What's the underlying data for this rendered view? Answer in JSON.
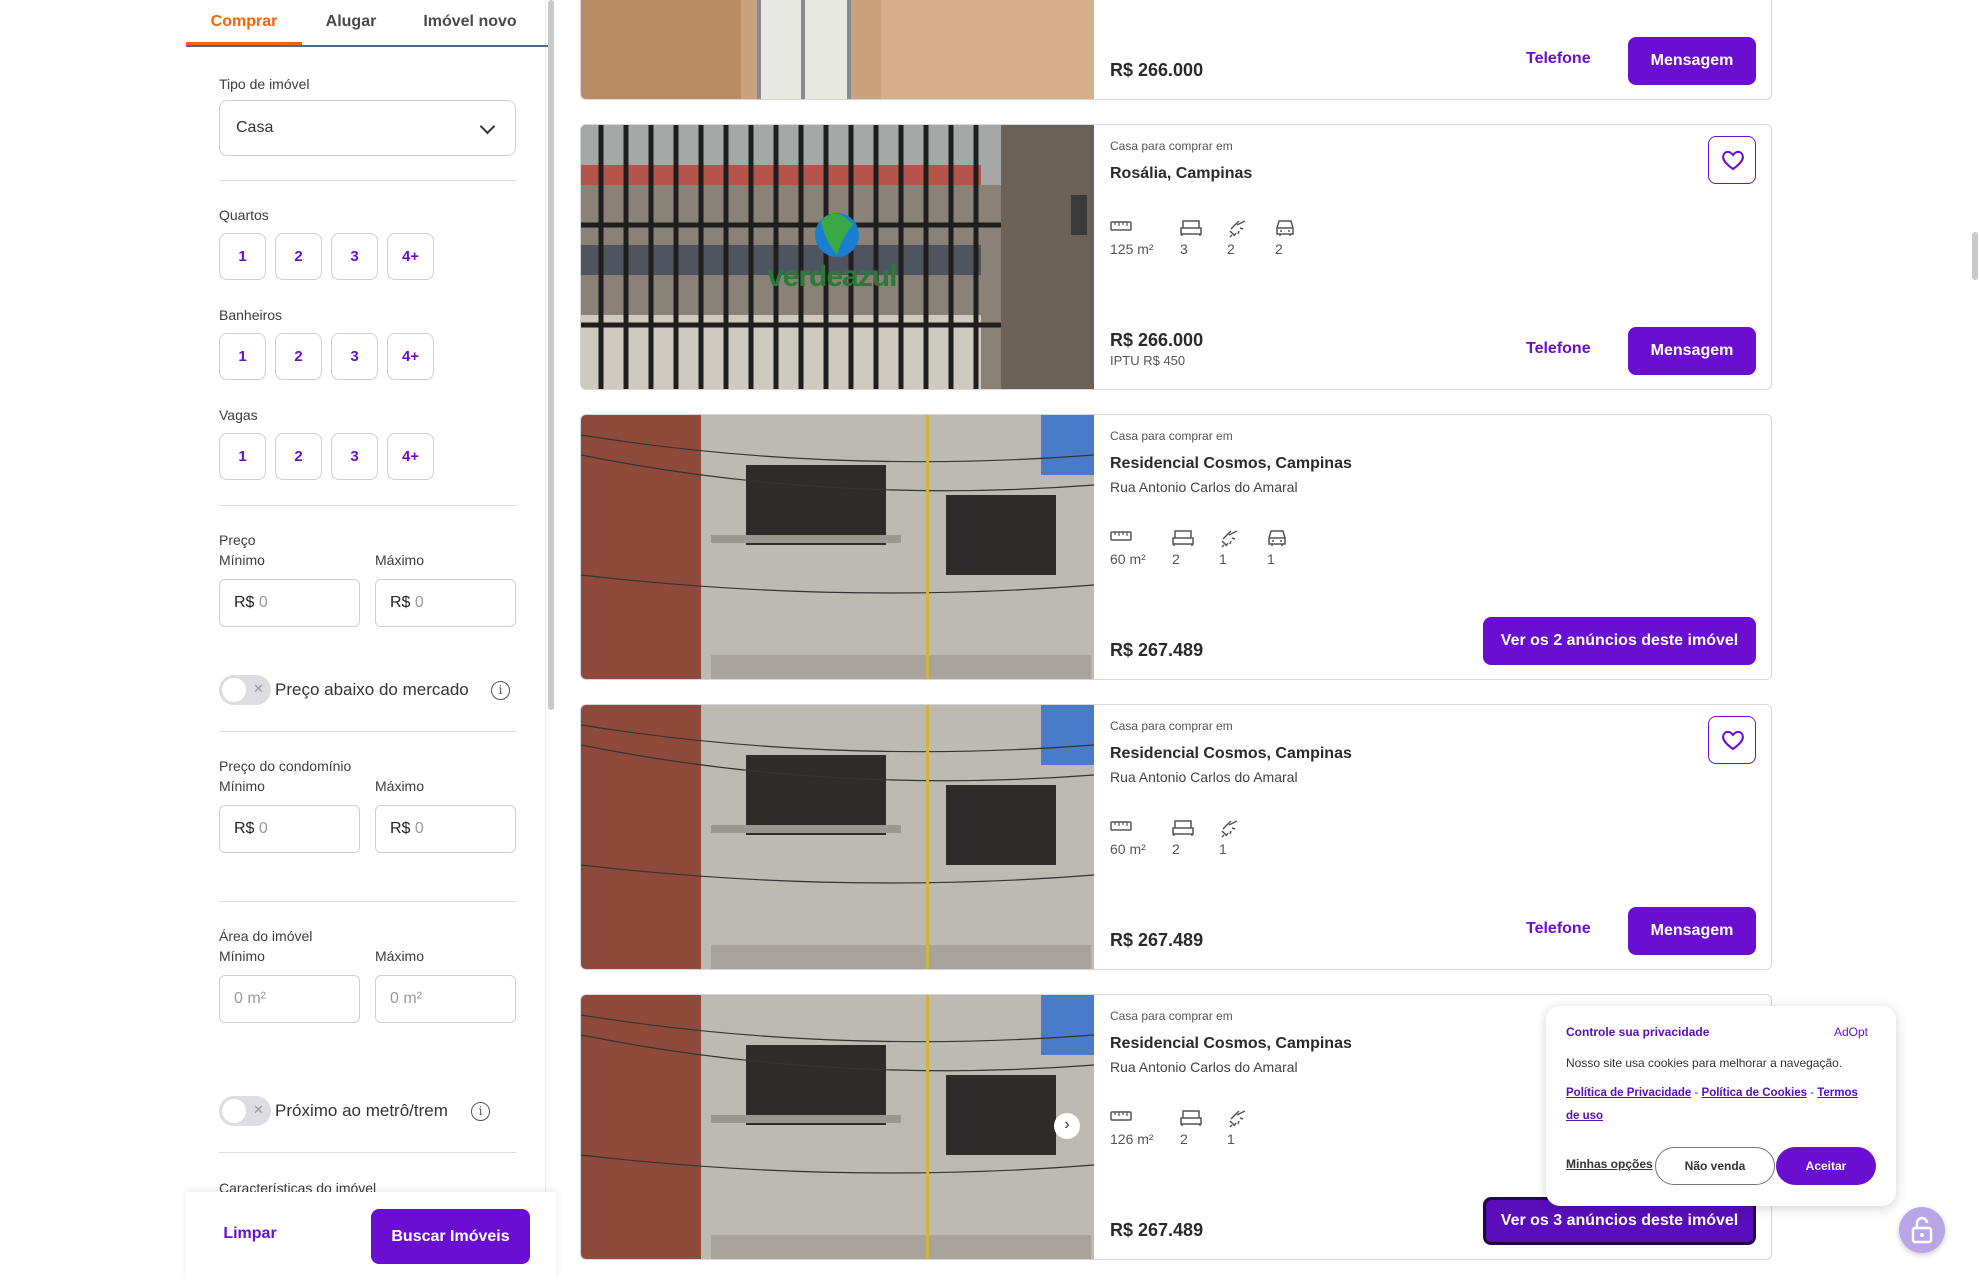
{
  "sidebar": {
    "tabs": [
      {
        "label": "Comprar",
        "active": true
      },
      {
        "label": "Alugar",
        "active": false
      },
      {
        "label": "Imóvel novo",
        "active": false
      }
    ],
    "tipo_label": "Tipo de imóvel",
    "tipo_value": "Casa",
    "quartos_label": "Quartos",
    "banheiros_label": "Banheiros",
    "vagas_label": "Vagas",
    "options": [
      "1",
      "2",
      "3",
      "4+"
    ],
    "preco_label": "Preço",
    "min_label": "Mínimo",
    "max_label": "Máximo",
    "currency": "R$",
    "zero_placeholder": "0",
    "area_placeholder": "0 m²",
    "abaixo_mercado_label": "Preço abaixo do mercado",
    "condominio_label": "Preço do condomínio",
    "area_label": "Área do imóvel",
    "metro_label": "Próximo ao metrô/trem",
    "caracteristicas_label": "Características do imóvel",
    "info_glyph": "i",
    "limpar_label": "Limpar",
    "buscar_label": "Buscar Imóveis"
  },
  "listings": [
    {
      "price": "R$ 266.000",
      "telefone_label": "Telefone",
      "mensagem_label": "Mensagem"
    },
    {
      "kicker": "Casa para comprar em",
      "location": "Rosália, Campinas",
      "area": "125 m²",
      "quartos": "3",
      "banheiros": "2",
      "vagas": "2",
      "price": "R$ 266.000",
      "iptu": "IPTU R$ 450",
      "telefone_label": "Telefone",
      "mensagem_label": "Mensagem",
      "watermark": "verdeazul"
    },
    {
      "kicker": "Casa para comprar em",
      "location": "Residencial Cosmos, Campinas",
      "street": "Rua Antonio Carlos do Amaral",
      "area": "60 m²",
      "quartos": "2",
      "banheiros": "1",
      "vagas": "1",
      "price": "R$ 267.489",
      "ver_label": "Ver os 2 anúncios deste imóvel"
    },
    {
      "kicker": "Casa para comprar em",
      "location": "Residencial Cosmos, Campinas",
      "street": "Rua Antonio Carlos do Amaral",
      "area": "60 m²",
      "quartos": "2",
      "banheiros": "1",
      "price": "R$ 267.489",
      "telefone_label": "Telefone",
      "mensagem_label": "Mensagem"
    },
    {
      "kicker": "Casa para comprar em",
      "location": "Residencial Cosmos, Campinas",
      "street": "Rua Antonio Carlos do Amaral",
      "area": "126 m²",
      "quartos": "2",
      "banheiros": "1",
      "price": "R$ 267.489",
      "ver_label": "Ver os 3 anúncios deste imóvel"
    }
  ],
  "cookie": {
    "title": "Controle sua privacidade",
    "brand": "AdOpt",
    "text": "Nosso site usa cookies para melhorar a navegação.",
    "link1": "Política de Privacidade",
    "sep": "-",
    "link2": "Política de Cookies",
    "link3a": "Termos",
    "link3b": "de uso",
    "opcoes": "Minhas opções",
    "naovenda": "Não venda",
    "aceitar": "Aceitar"
  },
  "colors": {
    "accent": "#6a0fd1",
    "tab_active": "#ff6000"
  }
}
